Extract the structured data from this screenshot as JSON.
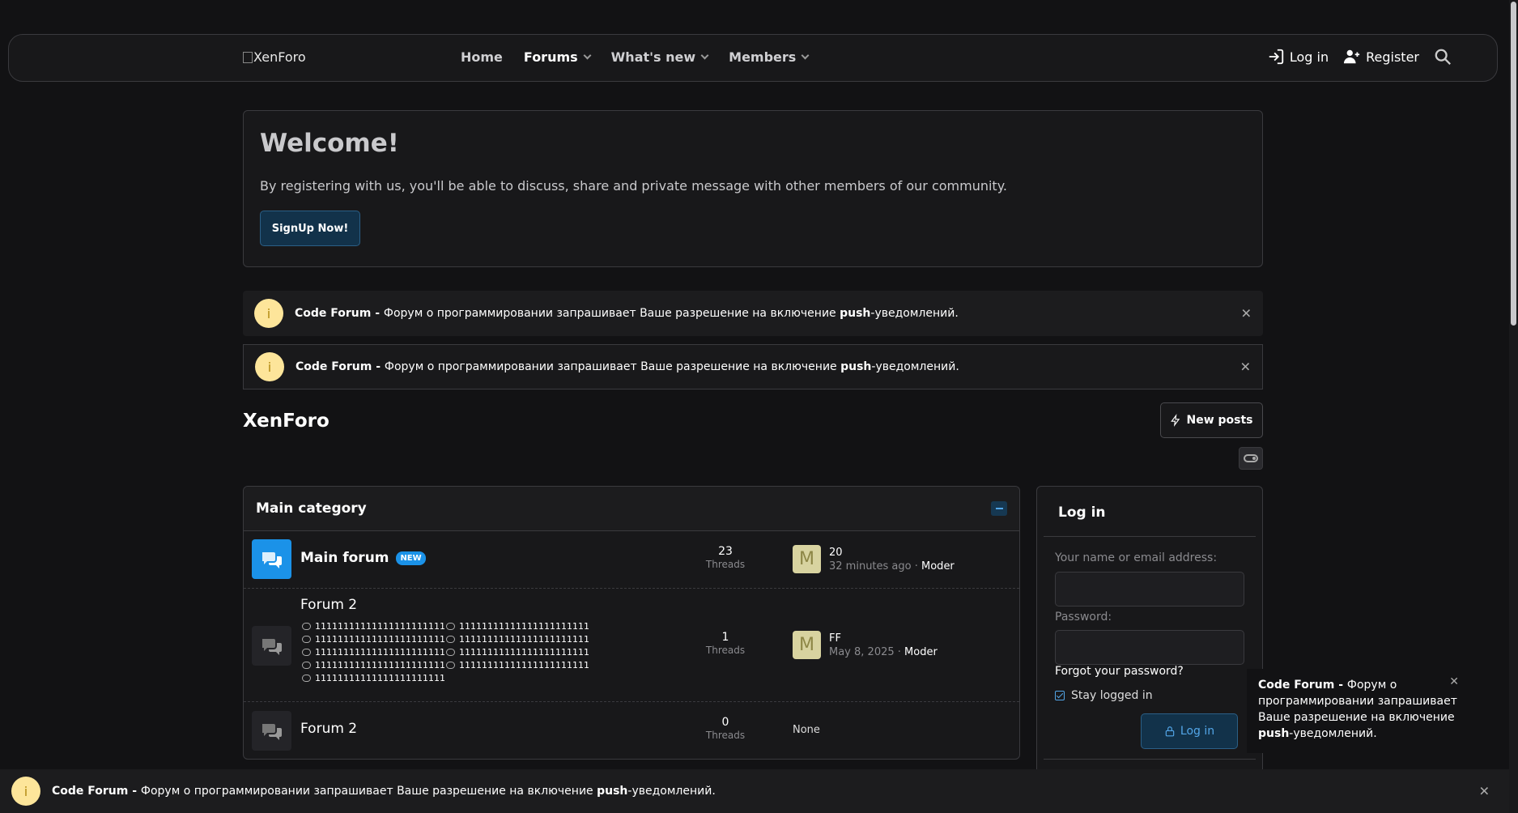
{
  "header": {
    "logo_alt": "XenForo",
    "nav": [
      {
        "label": "Home"
      },
      {
        "label": "Forums"
      },
      {
        "label": "What's new"
      },
      {
        "label": "Members"
      }
    ],
    "login_label": "Log in",
    "register_label": "Register"
  },
  "welcome": {
    "title": "Welcome!",
    "text": "By registering with us, you'll be able to discuss, share and private message with other members of our community.",
    "button": "SignUp Now!"
  },
  "notice": {
    "site": "Code Forum - ",
    "text": "Форум о программировании запрашивает Ваше разрешение на включение ",
    "push": "push",
    "tail": "-уведомлений."
  },
  "forum_home": {
    "title": "XenForo",
    "new_posts": "New posts"
  },
  "category": {
    "title": "Main category",
    "forums": [
      {
        "name": "Main forum",
        "badge": "NEW",
        "threads": "23",
        "threads_label": "Threads",
        "last_title": "20",
        "last_time": "32 minutes ago",
        "last_user": "Moder",
        "avatar": "M"
      },
      {
        "name": "Forum 2",
        "threads": "1",
        "threads_label": "Threads",
        "last_title": "FF",
        "last_time": "May 8, 2025",
        "last_user": "Moder",
        "avatar": "M",
        "subforums": [
          "1111111111111111111111111111111",
          "1111111111111111111111111111111",
          "1111111111111111111111111111111",
          "1111111111111111111111111111111",
          "1111111111111111111111111111111",
          "1111111111111111111111111111111",
          "1111111111111111111111111111111",
          "1111111111111111111111111111111",
          "1111111111111111111111111111111"
        ]
      },
      {
        "name": "Forum 2",
        "threads": "0",
        "threads_label": "Threads",
        "last_none": "None"
      }
    ]
  },
  "login_block": {
    "title": "Log in",
    "name_label": "Your name or email address:",
    "password_label": "Password:",
    "forgot": "Forgot your password?",
    "stay": "Stay logged in",
    "button": "Log in"
  },
  "colors": {
    "background": "#121214",
    "accent": "#1b92e8",
    "notice_icon": "#fde59a"
  }
}
